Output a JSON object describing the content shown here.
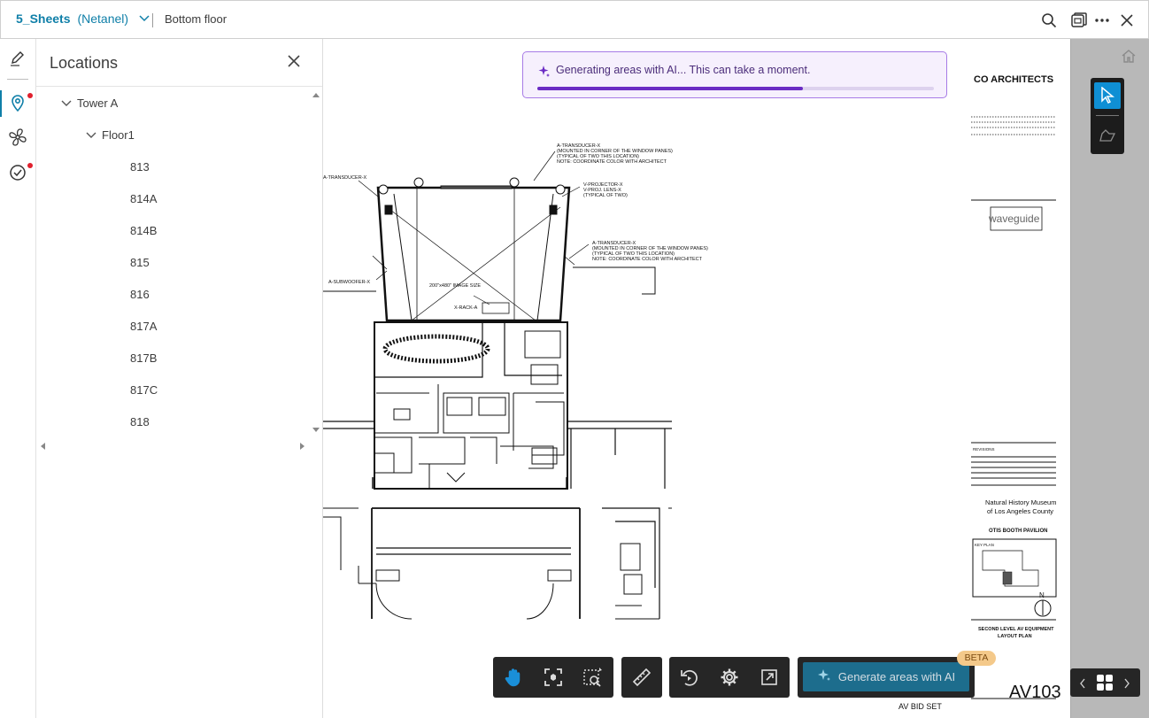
{
  "header": {
    "project_name": "5_Sheets",
    "project_owner": "(Netanel)",
    "sheet_title": "Bottom floor"
  },
  "sidebar_rail": {
    "items": [
      "markup-icon",
      "location-pin-icon",
      "fan-icon",
      "checklist-icon"
    ]
  },
  "locations_panel": {
    "title": "Locations",
    "tree": {
      "building": "Tower A",
      "floor": "Floor1",
      "rooms": [
        "813",
        "814A",
        "814B",
        "815",
        "816",
        "817A",
        "817B",
        "817C",
        "818"
      ]
    }
  },
  "ai_toast": {
    "message": "Generating areas with AI... This can take a moment.",
    "progress": 0.67
  },
  "toolbar": {
    "generate_label": "Generate areas with AI",
    "beta_label": "BETA"
  },
  "sheet": {
    "firm": "CO ARCHITECTS",
    "consultant": "waveguide",
    "project_line1": "Natural History Museum",
    "project_line2": "of Los Angeles County",
    "project_line3": "OTIS BOOTH PAVILION",
    "sheet_desc1": "SECOND LEVEL AV EQUIPMENT",
    "sheet_desc2": "LAYOUT PLAN",
    "sheet_number": "AV103",
    "set_label": "AV BID SET",
    "revisions_label": "REVISIONS",
    "north_label": "N",
    "key_plan_label": "KEY PLAN",
    "notes": [
      "A-TRANSDUCER-X",
      "(MOUNTED IN CORNER OF THE WINDOW PANES)",
      "(TYPICAL OF TWO THIS LOCATION)",
      "NOTE: COORDINATE COLOR WITH ARCHITECT",
      "V-PROJECTOR-X",
      "V-PROJ. LENS-X",
      "(TYPICAL OF TWO)",
      "A-SUBWOOFER-X",
      "200\"x480\" IMAGE SIZE",
      "X-RACK-A"
    ]
  },
  "colors": {
    "accent": "#0f7fa8",
    "toast_border": "#a77be6",
    "toast_bg": "#f6f0fd",
    "progress": "#6a2bc4",
    "toolbar_bg": "#262626",
    "generate_bg": "#1d6d8d",
    "beta_bg": "#f4c98a",
    "notification_dot": "#e0202d"
  }
}
